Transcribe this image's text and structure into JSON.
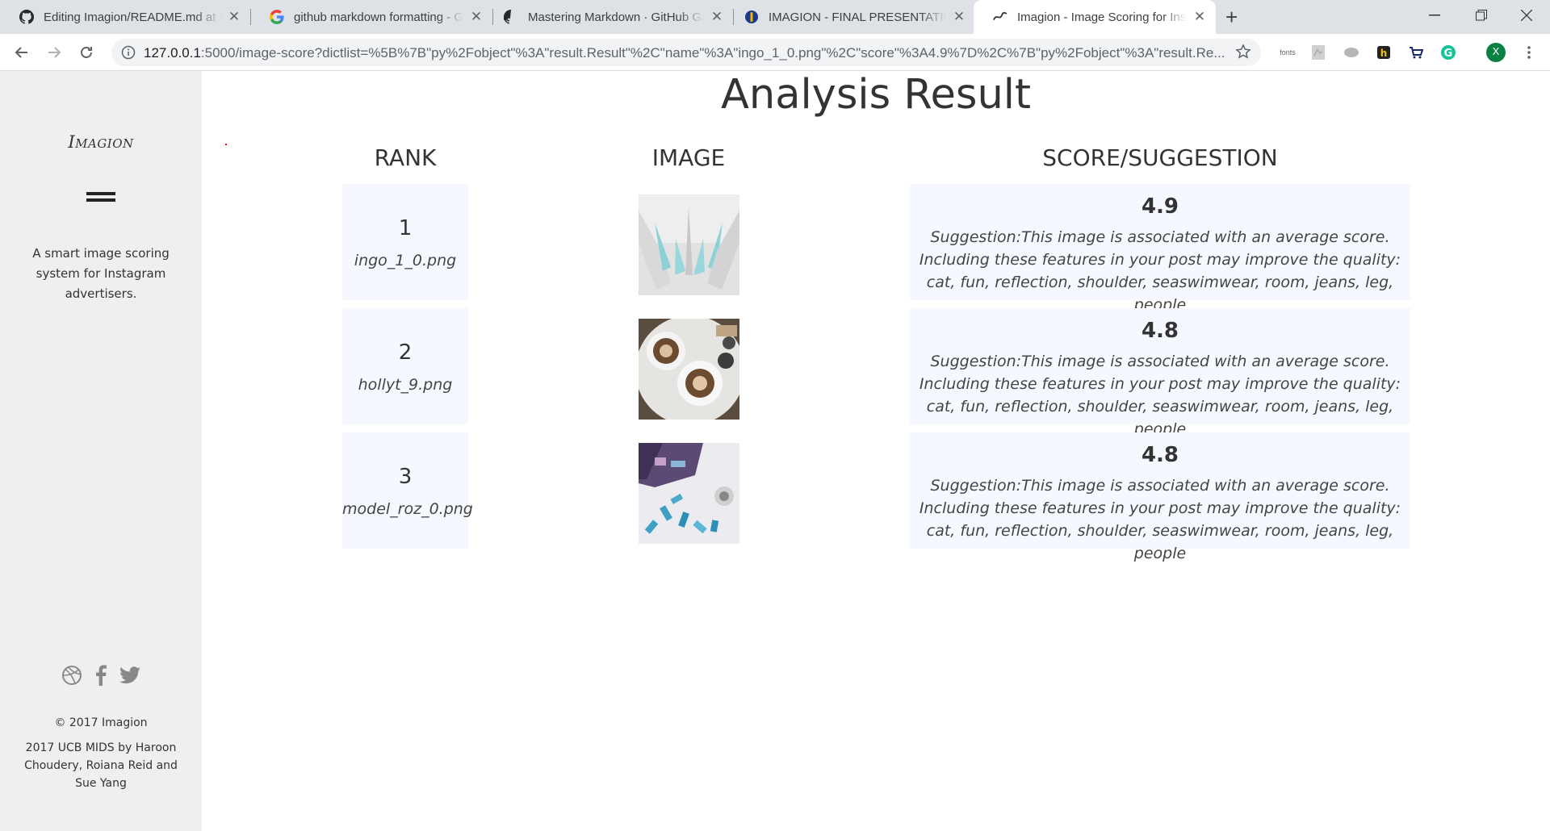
{
  "browser": {
    "tabs": [
      {
        "title": "Editing Imagion/README.md at master",
        "icon": "github-icon"
      },
      {
        "title": "github markdown formatting - Google Search",
        "icon": "google-icon"
      },
      {
        "title": "Mastering Markdown · GitHub Guides",
        "icon": "github-icon"
      },
      {
        "title": "IMAGION - FINAL PRESENTATION",
        "icon": "slides-icon"
      },
      {
        "title": "Imagion - Image Scoring for Instagram",
        "icon": "imagion-icon"
      }
    ],
    "url_host": "127.0.0.1",
    "url_rest": ":5000/image-score?dictlist=%5B%7B\"py%2Fobject\"%3A\"result.Result\"%2C\"name\"%3A\"ingo_1_0.png\"%2C\"score\"%3A4.9%7D%2C%7B\"py%2Fobject\"%3A\"result.Re...",
    "extension_fonts_label": "fonts",
    "profile_initial": "X"
  },
  "sidebar": {
    "logo": "Imagion",
    "tagline": "A smart image scoring system for Instagram advertisers.",
    "social": [
      "dribbble-icon",
      "facebook-icon",
      "twitter-icon"
    ],
    "copyright": "© 2017 Imagion",
    "credits": "2017 UCB MIDS by Haroon Choudery, Roiana Reid and Sue Yang"
  },
  "main": {
    "title": "Analysis Result",
    "headers": {
      "rank": "RANK",
      "image": "IMAGE",
      "score": "SCORE/SUGGESTION"
    },
    "rows": [
      {
        "rank": "1",
        "filename": "ingo_1_0.png",
        "score": "4.9",
        "suggestion": "Suggestion:This image is associated with an average score. Including these features in your post may improve the quality: cat, fun, reflection, shoulder, seaswimwear, room, jeans, leg, people"
      },
      {
        "rank": "2",
        "filename": "hollyt_9.png",
        "score": "4.8",
        "suggestion": "Suggestion:This image is associated with an average score. Including these features in your post may improve the quality: cat, fun, reflection, shoulder, seaswimwear, room, jeans, leg, people"
      },
      {
        "rank": "3",
        "filename": "model_roz_0.png",
        "score": "4.8",
        "suggestion": "Suggestion:This image is associated with an average score. Including these features in your post may improve the quality: cat, fun, reflection, shoulder, seaswimwear, room, jeans, leg, people"
      }
    ]
  },
  "colors": {
    "sidebar_bg": "#efefef",
    "cell_bg": "#f5f9ff",
    "text": "#333333"
  }
}
